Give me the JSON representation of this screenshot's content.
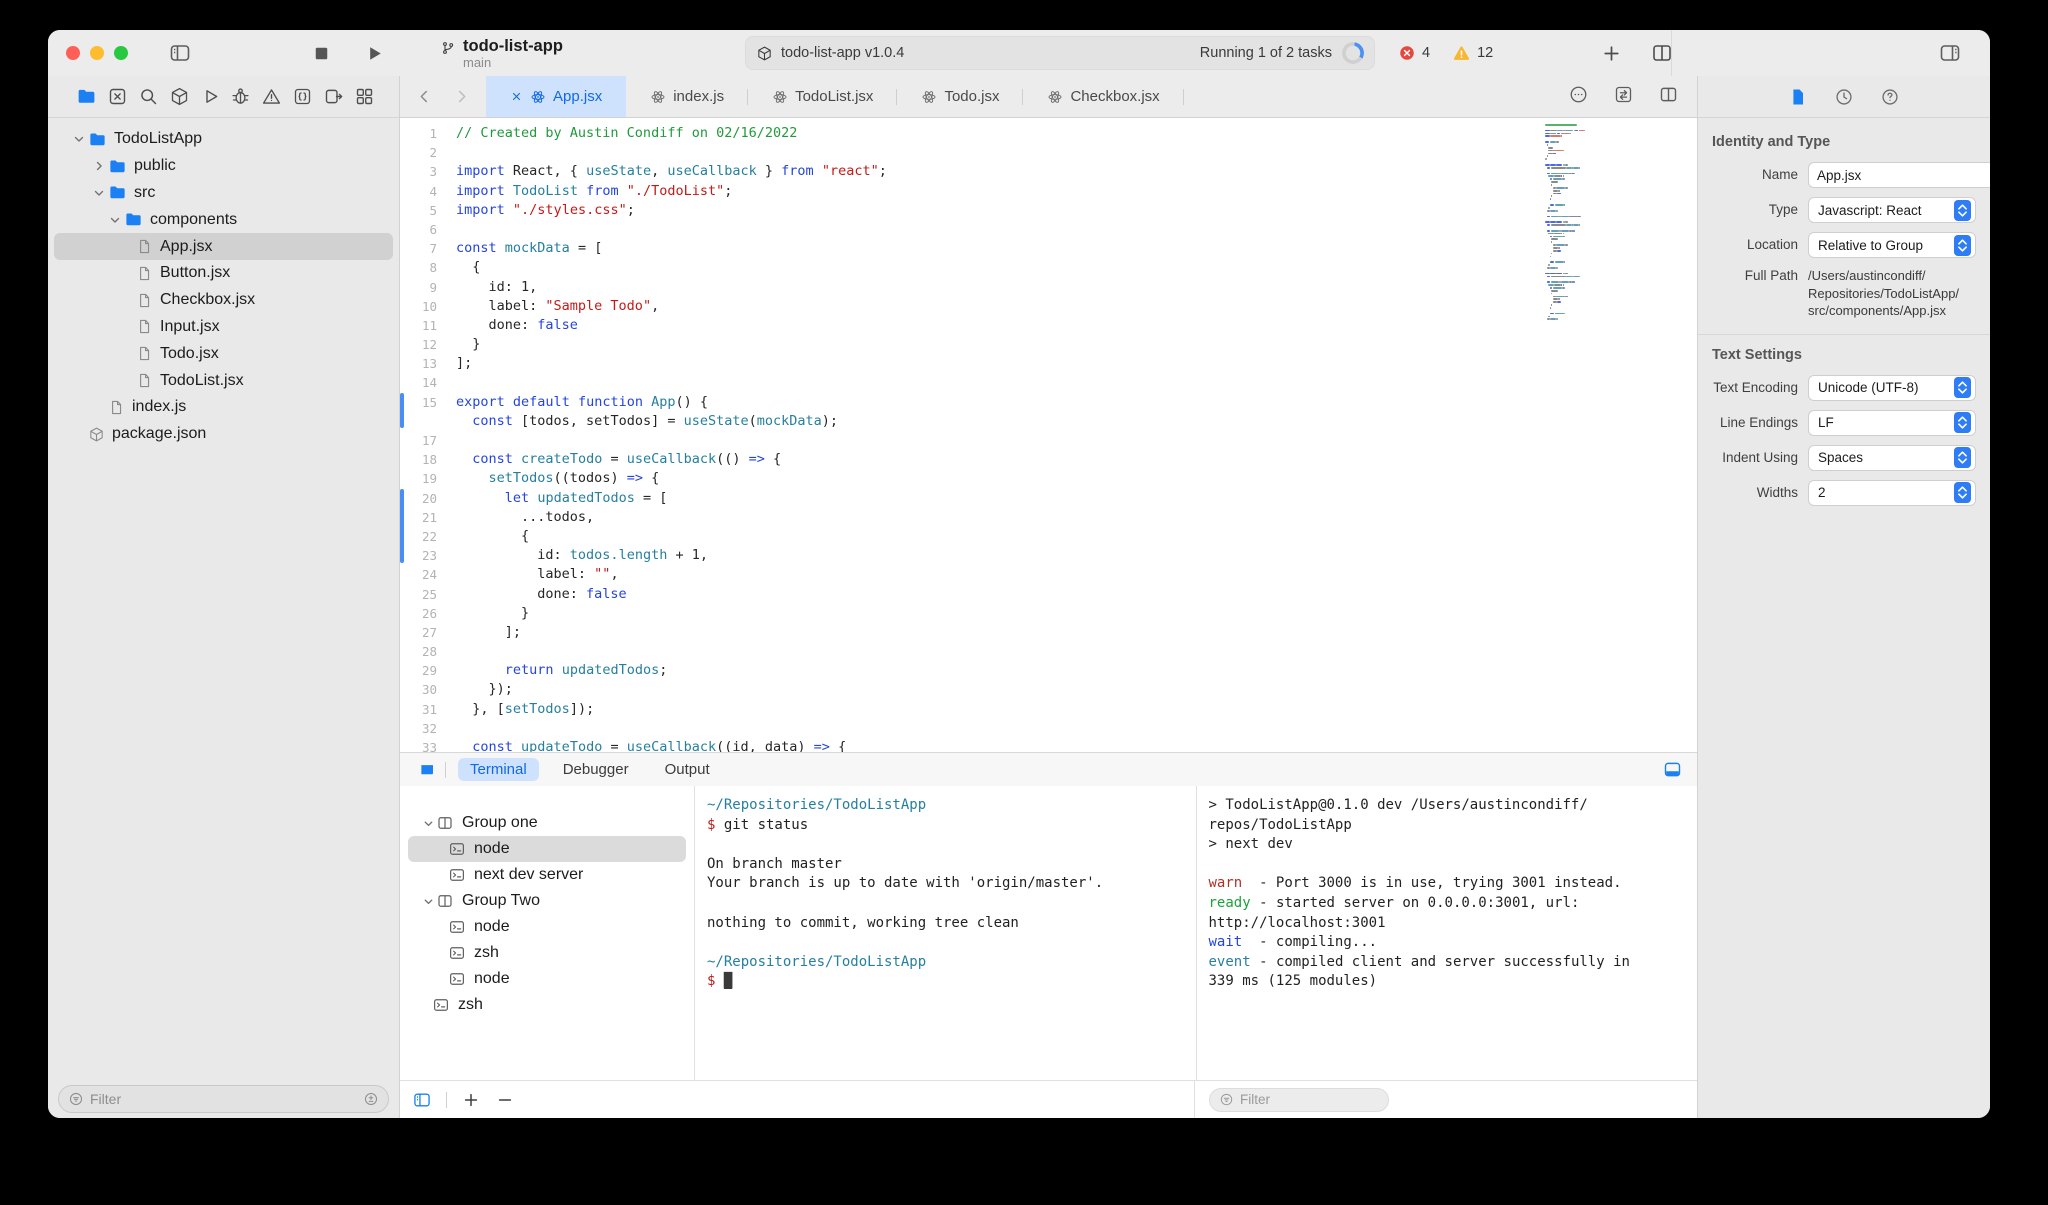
{
  "colors": {
    "accent": "#1b80f4",
    "tab_active_bg": "#cfe2fd",
    "error_badge": "#e5483e",
    "warning_badge": "#f7b731"
  },
  "titlebar": {
    "project": "todo-list-app",
    "branch": "main",
    "status_app": "todo-list-app v1.0.4",
    "status_tasks": "Running 1 of 2 tasks",
    "errors": "4",
    "warnings": "12"
  },
  "navigator": {
    "icons": [
      "folder",
      "square-x",
      "search",
      "package",
      "play",
      "bug",
      "warning",
      "braces",
      "extension",
      "grid"
    ],
    "active_icon": 0,
    "files": [
      {
        "label": "TodoListApp",
        "icon": "folder",
        "chevron": "down",
        "depth": 0
      },
      {
        "label": "public",
        "icon": "folder",
        "chevron": "right",
        "depth": 1
      },
      {
        "label": "src",
        "icon": "folder",
        "chevron": "down",
        "depth": 1
      },
      {
        "label": "components",
        "icon": "folder",
        "chevron": "down",
        "depth": 2
      },
      {
        "label": "App.jsx",
        "icon": "file",
        "depth": 3,
        "selected": true
      },
      {
        "label": "Button.jsx",
        "icon": "file",
        "depth": 3
      },
      {
        "label": "Checkbox.jsx",
        "icon": "file",
        "depth": 3
      },
      {
        "label": "Input.jsx",
        "icon": "file",
        "depth": 3
      },
      {
        "label": "Todo.jsx",
        "icon": "file",
        "depth": 3
      },
      {
        "label": "TodoList.jsx",
        "icon": "file",
        "depth": 3
      },
      {
        "label": "index.js",
        "icon": "file",
        "depth": 1
      },
      {
        "label": "package.json",
        "icon": "package",
        "depth": 0
      }
    ],
    "filter_placeholder": "Filter"
  },
  "tabs": {
    "items": [
      {
        "label": "App.jsx",
        "icon": "atom",
        "active": true
      },
      {
        "label": "index.js",
        "icon": "atom"
      },
      {
        "label": "TodoList.jsx",
        "icon": "atom"
      },
      {
        "label": "Todo.jsx",
        "icon": "atom"
      },
      {
        "label": "Checkbox.jsx",
        "icon": "atom"
      }
    ]
  },
  "editor": {
    "token_colors": {
      "k": "#2444df",
      "t": "#267f9f",
      "s": "#c41a16",
      "c": "#219a3b",
      "p": "#262626"
    },
    "changed_ranges": [
      [
        15,
        16
      ],
      [
        20,
        23
      ]
    ],
    "line_numbers": [
      "1",
      "2",
      "3",
      "4",
      "5",
      "6",
      "7",
      "8",
      "9",
      "10",
      "11",
      "12",
      "13",
      "14",
      "15",
      "",
      "17",
      "18",
      "19",
      "20",
      "21",
      "22",
      "23",
      "24",
      "25",
      "26",
      "27",
      "28",
      "29",
      "30",
      "31",
      "32",
      "33"
    ],
    "lines": [
      [
        [
          "c",
          "// Created by Austin Condiff on 02/16/2022"
        ]
      ],
      [],
      [
        [
          "k",
          "import"
        ],
        [
          "p",
          " React, { "
        ],
        [
          "t",
          "useState"
        ],
        [
          "p",
          ", "
        ],
        [
          "t",
          "useCallback"
        ],
        [
          "p",
          " } "
        ],
        [
          "k",
          "from"
        ],
        [
          "p",
          " "
        ],
        [
          "s",
          "\"react\""
        ],
        [
          "p",
          ";"
        ]
      ],
      [
        [
          "k",
          "import"
        ],
        [
          "p",
          " "
        ],
        [
          "t",
          "TodoList"
        ],
        [
          "p",
          " "
        ],
        [
          "k",
          "from"
        ],
        [
          "p",
          " "
        ],
        [
          "s",
          "\"./TodoList\""
        ],
        [
          "p",
          ";"
        ]
      ],
      [
        [
          "k",
          "import"
        ],
        [
          "p",
          " "
        ],
        [
          "s",
          "\"./styles.css\""
        ],
        [
          "p",
          ";"
        ]
      ],
      [],
      [
        [
          "k",
          "const"
        ],
        [
          "p",
          " "
        ],
        [
          "t",
          "mockData"
        ],
        [
          "p",
          " = ["
        ]
      ],
      [
        [
          "p",
          "  {"
        ]
      ],
      [
        [
          "p",
          "    id: 1,"
        ]
      ],
      [
        [
          "p",
          "    label: "
        ],
        [
          "s",
          "\"Sample Todo\""
        ],
        [
          "p",
          ","
        ]
      ],
      [
        [
          "p",
          "    done: "
        ],
        [
          "k",
          "false"
        ]
      ],
      [
        [
          "p",
          "  }"
        ]
      ],
      [
        [
          "p",
          "];"
        ]
      ],
      [],
      [
        [
          "k",
          "export"
        ],
        [
          "p",
          " "
        ],
        [
          "k",
          "default"
        ],
        [
          "p",
          " "
        ],
        [
          "k",
          "function"
        ],
        [
          "p",
          " "
        ],
        [
          "t",
          "App"
        ],
        [
          "p",
          "() {"
        ]
      ],
      [
        [
          "p",
          "  "
        ],
        [
          "k",
          "const"
        ],
        [
          "p",
          " [todos, setTodos] = "
        ],
        [
          "t",
          "useState"
        ],
        [
          "p",
          "("
        ],
        [
          "t",
          "mockData"
        ],
        [
          "p",
          ");"
        ]
      ],
      [],
      [
        [
          "p",
          "  "
        ],
        [
          "k",
          "const"
        ],
        [
          "p",
          " "
        ],
        [
          "t",
          "createTodo"
        ],
        [
          "p",
          " = "
        ],
        [
          "t",
          "useCallback"
        ],
        [
          "p",
          "(() "
        ],
        [
          "k",
          "=>"
        ],
        [
          "p",
          " {"
        ]
      ],
      [
        [
          "p",
          "    "
        ],
        [
          "t",
          "setTodos"
        ],
        [
          "p",
          "((todos) "
        ],
        [
          "k",
          "=>"
        ],
        [
          "p",
          " {"
        ]
      ],
      [
        [
          "p",
          "      "
        ],
        [
          "k",
          "let"
        ],
        [
          "p",
          " "
        ],
        [
          "t",
          "updatedTodos"
        ],
        [
          "p",
          " = ["
        ]
      ],
      [
        [
          "p",
          "        ...todos,"
        ]
      ],
      [
        [
          "p",
          "        {"
        ]
      ],
      [
        [
          "p",
          "          id: "
        ],
        [
          "t",
          "todos.length"
        ],
        [
          "p",
          " + 1,"
        ]
      ],
      [
        [
          "p",
          "          label: "
        ],
        [
          "s",
          "\"\""
        ],
        [
          "p",
          ","
        ]
      ],
      [
        [
          "p",
          "          done: "
        ],
        [
          "k",
          "false"
        ]
      ],
      [
        [
          "p",
          "        }"
        ]
      ],
      [
        [
          "p",
          "      ];"
        ]
      ],
      [],
      [
        [
          "p",
          "      "
        ],
        [
          "k",
          "return"
        ],
        [
          "p",
          " "
        ],
        [
          "t",
          "updatedTodos"
        ],
        [
          "p",
          ";"
        ]
      ],
      [
        [
          "p",
          "    });"
        ]
      ],
      [
        [
          "p",
          "  }, ["
        ],
        [
          "t",
          "setTodos"
        ],
        [
          "p",
          "]);"
        ]
      ],
      [],
      [
        [
          "p",
          "  "
        ],
        [
          "k",
          "const"
        ],
        [
          "p",
          " "
        ],
        [
          "t",
          "updateTodo"
        ],
        [
          "p",
          " = "
        ],
        [
          "t",
          "useCallback"
        ],
        [
          "p",
          "((id, data) "
        ],
        [
          "k",
          "=>"
        ],
        [
          "p",
          " {"
        ]
      ]
    ]
  },
  "bottom_panel": {
    "tabs": [
      "Terminal",
      "Debugger",
      "Output"
    ],
    "active_tab": "Terminal",
    "sessions": [
      {
        "kind": "group",
        "label": "Group one",
        "chevron": "down"
      },
      {
        "kind": "terminal",
        "label": "node",
        "selected": true
      },
      {
        "kind": "terminal",
        "label": "next dev server"
      },
      {
        "kind": "group",
        "label": "Group Two",
        "chevron": "down"
      },
      {
        "kind": "terminal",
        "label": "node"
      },
      {
        "kind": "terminal",
        "label": "zsh"
      },
      {
        "kind": "terminal",
        "label": "node"
      },
      {
        "kind": "terminal",
        "label": "zsh",
        "root": true
      }
    ],
    "terminal_colors": {
      "text": "#222222",
      "path": "#267f9f",
      "prompt": "#c41a16",
      "warn": "#b03028",
      "ready": "#1fa13c",
      "wait": "#2444df",
      "event": "#267f9f"
    },
    "left_terminal": [
      [
        [
          "path",
          "~/Repositories/TodoListApp"
        ]
      ],
      [
        [
          "prompt",
          "$ "
        ],
        [
          "p",
          "git status"
        ]
      ],
      [],
      [
        [
          "p",
          "On branch master"
        ]
      ],
      [
        [
          "p",
          "Your branch is up to date with 'origin/master'."
        ]
      ],
      [],
      [
        [
          "p",
          "nothing to commit, working tree clean"
        ]
      ],
      [],
      [
        [
          "path",
          "~/Repositories/TodoListApp"
        ]
      ],
      [
        [
          "prompt",
          "$ "
        ],
        [
          "cursor",
          "█"
        ]
      ]
    ],
    "right_terminal": [
      [
        [
          "p",
          "> TodoListApp@0.1.0 dev /Users/austincondiff/"
        ]
      ],
      [
        [
          "p",
          "repos/TodoListApp"
        ]
      ],
      [
        [
          "p",
          "> next dev"
        ]
      ],
      [],
      [
        [
          "warn",
          "warn"
        ],
        [
          "p",
          "  - Port 3000 is in use, trying 3001 instead."
        ]
      ],
      [
        [
          "ready",
          "ready"
        ],
        [
          "p",
          " - started server on 0.0.0.0:3001, url:"
        ]
      ],
      [
        [
          "p",
          "http://localhost:3001"
        ]
      ],
      [
        [
          "wait",
          "wait"
        ],
        [
          "p",
          "  - compiling..."
        ]
      ],
      [
        [
          "event",
          "event"
        ],
        [
          "p",
          " - compiled client and server successfully in"
        ]
      ],
      [
        [
          "p",
          "339 ms (125 modules)"
        ]
      ]
    ],
    "filter_placeholder": "Filter"
  },
  "inspector": {
    "identity_header": "Identity and Type",
    "name_label": "Name",
    "name_value": "App.jsx",
    "type_label": "Type",
    "type_value": "Javascript: React",
    "location_label": "Location",
    "location_value": "Relative to Group",
    "fullpath_label": "Full Path",
    "fullpath_value": "/Users/austincondiff/\nRepositories/TodoListApp/\nsrc/components/App.jsx",
    "text_settings_header": "Text Settings",
    "encoding_label": "Text Encoding",
    "encoding_value": "Unicode (UTF-8)",
    "line_endings_label": "Line Endings",
    "line_endings_value": "LF",
    "indent_label": "Indent Using",
    "indent_value": "Spaces",
    "widths_label": "Widths",
    "widths_value": "2"
  }
}
